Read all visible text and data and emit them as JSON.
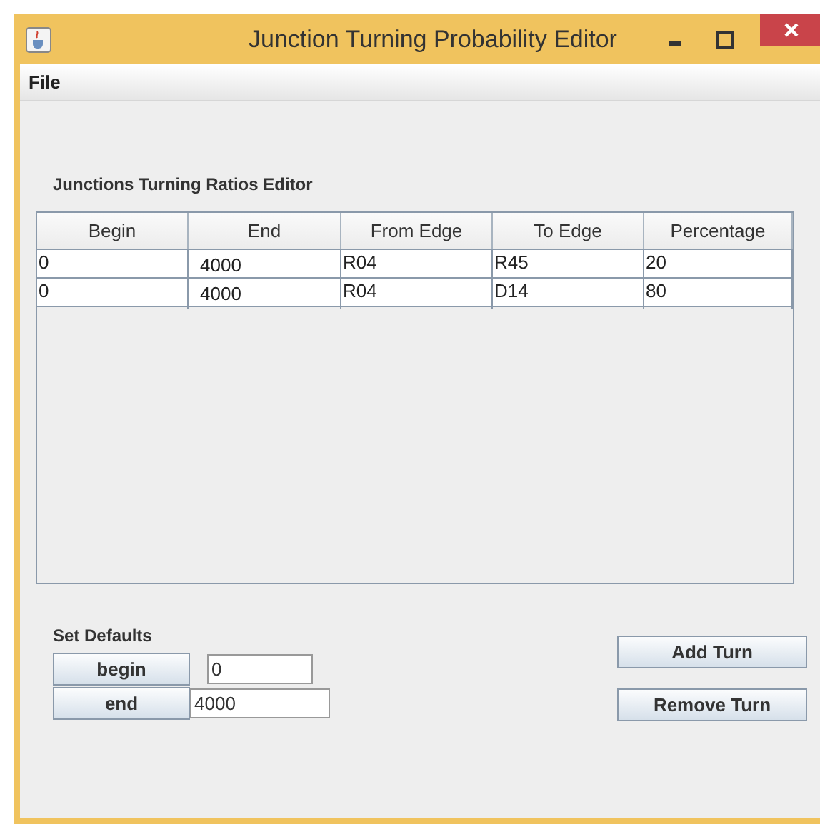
{
  "window": {
    "title": "Junction Turning Probability Editor"
  },
  "menu": [
    "File"
  ],
  "editor_title": "Junctions Turning Ratios Editor",
  "table": {
    "columns": [
      "Begin",
      "End",
      "From Edge",
      "To Edge",
      "Percentage"
    ],
    "rows": [
      [
        "0",
        "4000",
        "R04",
        "R45",
        "20"
      ],
      [
        "0",
        "4000",
        "R04",
        "D14",
        "80"
      ]
    ]
  },
  "defaults": {
    "title": "Set Defaults",
    "begin_button": "begin",
    "begin_value": "0",
    "end_button": "end",
    "end_value": "4000"
  },
  "buttons": [
    "Add Turn",
    "Remove Turn"
  ]
}
